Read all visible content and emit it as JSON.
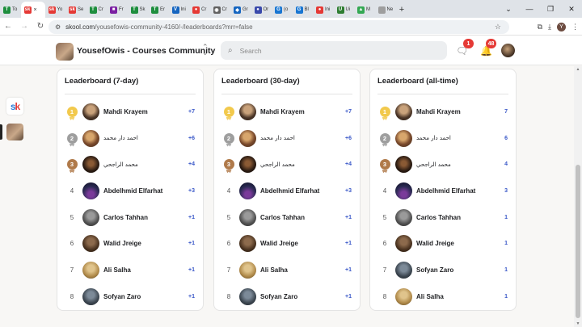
{
  "browser": {
    "tabs": [
      {
        "label": "To",
        "color": "#1e8e3e",
        "glyph": "T"
      },
      {
        "label": "×",
        "color": "#e53935",
        "glyph": "sk",
        "active": true
      },
      {
        "label": "Yo",
        "color": "#e53935",
        "glyph": "sk"
      },
      {
        "label": "Se",
        "color": "#e53935",
        "glyph": "sk"
      },
      {
        "label": "Cr",
        "color": "#1e8e3e",
        "glyph": "T"
      },
      {
        "label": "Fr",
        "color": "#7b1fa2",
        "glyph": "■"
      },
      {
        "label": "Sk",
        "color": "#1e8e3e",
        "glyph": "T"
      },
      {
        "label": "Er",
        "color": "#1e8e3e",
        "glyph": "T"
      },
      {
        "label": "Ini",
        "color": "#1565c0",
        "glyph": "V"
      },
      {
        "label": "Cr",
        "color": "#e53935",
        "glyph": "●"
      },
      {
        "label": "Cr",
        "color": "#616161",
        "glyph": "◉"
      },
      {
        "label": "Gr",
        "color": "#1565c0",
        "glyph": "◆"
      },
      {
        "label": "Or",
        "color": "#3949ab",
        "glyph": "●"
      },
      {
        "label": "(o",
        "color": "#1976d2",
        "glyph": "G"
      },
      {
        "label": "Bl",
        "color": "#1976d2",
        "glyph": "G"
      },
      {
        "label": "Ini",
        "color": "#e53935",
        "glyph": "●"
      },
      {
        "label": "Ui",
        "color": "#2e7d32",
        "glyph": "U"
      },
      {
        "label": "M",
        "color": "#34a853",
        "glyph": "▲"
      },
      {
        "label": "Ne",
        "color": "#9e9e9e",
        "glyph": " "
      }
    ],
    "new_tab": "+",
    "window_controls": {
      "minimize": "—",
      "maximize": "❐",
      "close": "✕"
    },
    "url_host": "skool.com",
    "url_path": "/yousefowis-community-4160/-/leaderboards?mrr=false",
    "profile_letter": "Y"
  },
  "header": {
    "community_name": "YousefOwis - Courses Community",
    "search_placeholder": "Search",
    "chat_badge": "1",
    "notification_badge": "48"
  },
  "leaderboards": [
    {
      "title": "Leaderboard (7-day)",
      "rows": [
        {
          "rank": "1",
          "name": "Mahdi Krayem",
          "points": "+7",
          "avatar": "av-mahdi"
        },
        {
          "rank": "2",
          "name": "احمد دار محمد",
          "points": "+6",
          "avatar": "av-ahmed",
          "rtl": true
        },
        {
          "rank": "3",
          "name": "محمد الراجحي",
          "points": "+4",
          "avatar": "av-rajhi",
          "rtl": true
        },
        {
          "rank": "4",
          "name": "Abdelhmid Elfarhat",
          "points": "+3",
          "avatar": "av-abdel"
        },
        {
          "rank": "5",
          "name": "Carlos Tahhan",
          "points": "+1",
          "avatar": "av-carlos"
        },
        {
          "rank": "6",
          "name": "Walid Jreige",
          "points": "+1",
          "avatar": "av-walid"
        },
        {
          "rank": "7",
          "name": "Ali Salha",
          "points": "+1",
          "avatar": "av-ali"
        },
        {
          "rank": "8",
          "name": "Sofyan Zaro",
          "points": "+1",
          "avatar": "av-sofyan"
        }
      ]
    },
    {
      "title": "Leaderboard (30-day)",
      "rows": [
        {
          "rank": "1",
          "name": "Mahdi Krayem",
          "points": "+7",
          "avatar": "av-mahdi"
        },
        {
          "rank": "2",
          "name": "احمد دار محمد",
          "points": "+6",
          "avatar": "av-ahmed",
          "rtl": true
        },
        {
          "rank": "3",
          "name": "محمد الراجحي",
          "points": "+4",
          "avatar": "av-rajhi",
          "rtl": true
        },
        {
          "rank": "4",
          "name": "Abdelhmid Elfarhat",
          "points": "+3",
          "avatar": "av-abdel"
        },
        {
          "rank": "5",
          "name": "Carlos Tahhan",
          "points": "+1",
          "avatar": "av-carlos"
        },
        {
          "rank": "6",
          "name": "Walid Jreige",
          "points": "+1",
          "avatar": "av-walid"
        },
        {
          "rank": "7",
          "name": "Ali Salha",
          "points": "+1",
          "avatar": "av-ali"
        },
        {
          "rank": "8",
          "name": "Sofyan Zaro",
          "points": "+1",
          "avatar": "av-sofyan"
        }
      ]
    },
    {
      "title": "Leaderboard (all-time)",
      "rows": [
        {
          "rank": "1",
          "name": "Mahdi Krayem",
          "points": "7",
          "avatar": "av-mahdi"
        },
        {
          "rank": "2",
          "name": "احمد دار محمد",
          "points": "6",
          "avatar": "av-ahmed",
          "rtl": true
        },
        {
          "rank": "3",
          "name": "محمد الراجحي",
          "points": "4",
          "avatar": "av-rajhi",
          "rtl": true
        },
        {
          "rank": "4",
          "name": "Abdelhmid Elfarhat",
          "points": "3",
          "avatar": "av-abdel"
        },
        {
          "rank": "5",
          "name": "Carlos Tahhan",
          "points": "1",
          "avatar": "av-carlos"
        },
        {
          "rank": "6",
          "name": "Walid Jreige",
          "points": "1",
          "avatar": "av-walid"
        },
        {
          "rank": "7",
          "name": "Sofyan Zaro",
          "points": "1",
          "avatar": "av-sofyan"
        },
        {
          "rank": "8",
          "name": "Ali Salha",
          "points": "1",
          "avatar": "av-ali"
        }
      ]
    }
  ],
  "colors": {
    "points": "#3a58c8",
    "gold": "#f2c94c",
    "silver": "#9e9e9e",
    "bronze": "#b07a4a",
    "badge": "#e53935"
  }
}
